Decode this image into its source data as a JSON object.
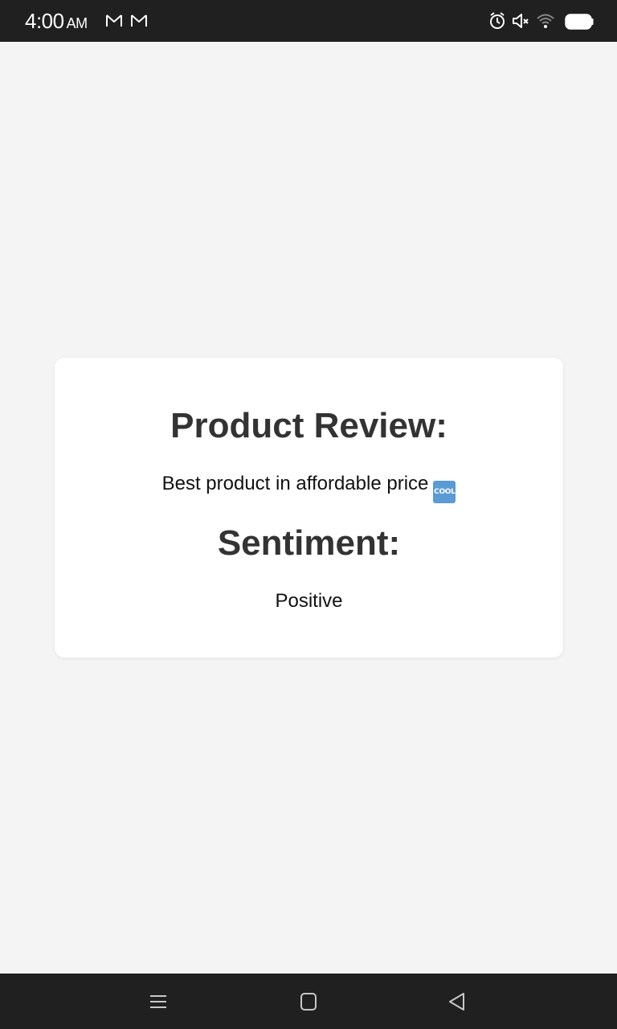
{
  "status_bar": {
    "time": "4:00",
    "ampm": "AM",
    "notifications": [
      "gmail-icon",
      "gmail-icon"
    ],
    "right_icons": [
      "alarm-icon",
      "mute-icon",
      "wifi-icon",
      "battery-icon"
    ]
  },
  "card": {
    "review_heading": "Product Review:",
    "review_text": "Best product in affordable price",
    "review_emoji": "COOL",
    "sentiment_heading": "Sentiment:",
    "sentiment_value": "Positive"
  },
  "nav_bar": {
    "buttons": [
      "recent-apps-icon",
      "home-icon",
      "back-icon"
    ]
  },
  "colors": {
    "background": "#f4f4f4",
    "card": "#ffffff",
    "heading": "#333333",
    "system_bars": "#202020",
    "emoji_accent": "#5b9bd5"
  }
}
